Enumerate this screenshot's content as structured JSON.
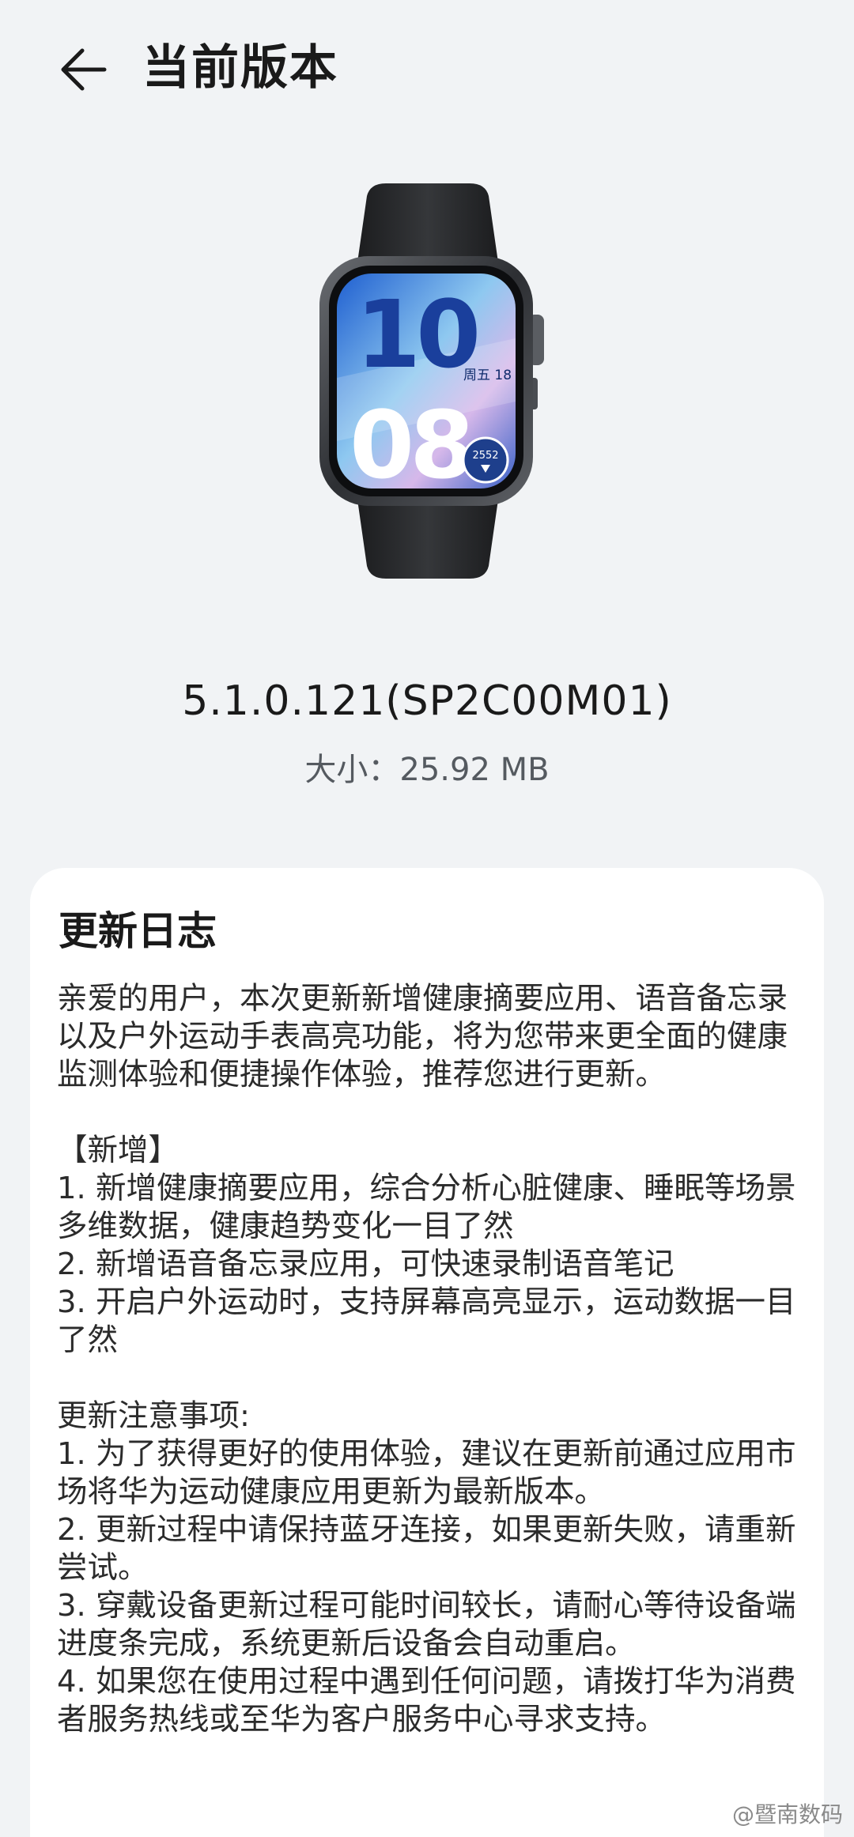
{
  "header": {
    "back_icon": "arrow-left-icon",
    "title": "当前版本"
  },
  "product_image": {
    "watch_time_hour": "10",
    "watch_time_minute": "08",
    "watch_date": "周五 18",
    "watch_steps": "2552"
  },
  "version": {
    "number": "5.1.0.121(SP2C00M01)",
    "size_label": "大小：",
    "size_value": "25.92 MB"
  },
  "changelog": {
    "title": "更新日志",
    "intro": "亲爱的用户，本次更新新增健康摘要应用、语音备忘录以及户外运动手表高亮功能，将为您带来更全面的健康监测体验和便捷操作体验，推荐您进行更新。",
    "new_heading": "【新增】",
    "new_items": [
      "1. 新增健康摘要应用，综合分析心脏健康、睡眠等场景多维数据，健康趋势变化一目了然",
      "2. 新增语音备忘录应用，可快速录制语音笔记",
      "3. 开启户外运动时，支持屏幕高亮显示，运动数据一目了然"
    ],
    "notes_heading": "更新注意事项:",
    "notes_items": [
      "1. 为了获得更好的使用体验，建议在更新前通过应用市场将华为运动健康应用更新为最新版本。",
      "2. 更新过程中请保持蓝牙连接，如果更新失败，请重新尝试。",
      "3. 穿戴设备更新过程可能时间较长，请耐心等待设备端进度条完成，系统更新后设备会自动重启。",
      "4. 如果您在使用过程中遇到任何问题，请拨打华为消费者服务热线或至华为客户服务中心寻求支持。"
    ]
  },
  "watermark": "@暨南数码",
  "colors": {
    "background": "#f1f3f5",
    "card": "#ffffff",
    "text_primary": "#1a1a1a",
    "text_secondary": "#555a60"
  }
}
